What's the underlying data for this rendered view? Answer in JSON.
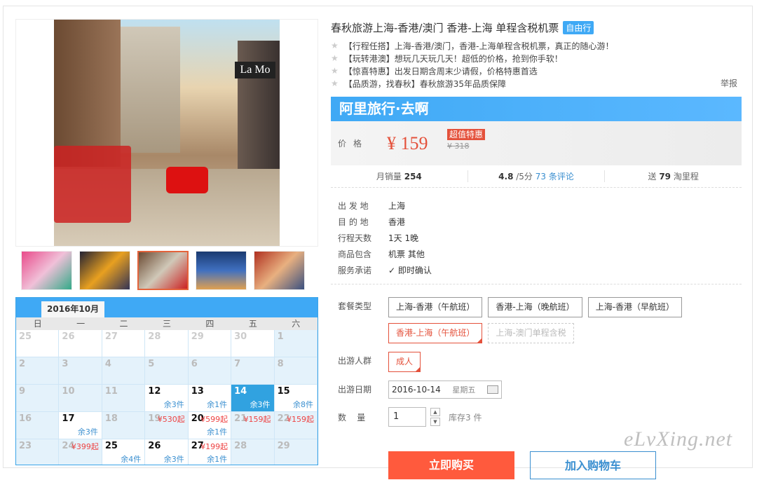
{
  "product": {
    "title": "春秋旅游上海-香港/澳门 香港-上海 单程含税机票",
    "tag": "自由行",
    "report": "举报",
    "features": [
      "【行程任搭】上海-香港/澳门，香港-上海单程含税机票，真正的随心游！",
      "【玩转港澳】想玩几天玩几天！超低的价格，抢到你手软！",
      "【惊喜特惠】出发日期含周末少请假，价格特惠首选",
      "【品质游，找春秋】春秋旅游35年品质保障"
    ]
  },
  "photo": {
    "sign": "La Mo"
  },
  "banner": "阿里旅行·去啊",
  "price": {
    "label": "价格",
    "value": "¥ 159",
    "badge": "超值特惠",
    "original": "¥ 318"
  },
  "stats": {
    "sales_label": "月销量",
    "sales": "254",
    "rating": "4.8",
    "rating_suffix": "/5分",
    "reviews": "73 条评论",
    "points_prefix": "送",
    "points": "79",
    "points_suffix": "淘里程"
  },
  "info": [
    {
      "k": "出 发 地",
      "v": "上海"
    },
    {
      "k": "目 的 地",
      "v": "香港"
    },
    {
      "k": "行程天数",
      "v": "1天 1晚"
    },
    {
      "k": "商品包含",
      "v": "机票  其他"
    },
    {
      "k": "服务承诺",
      "v": "即时确认"
    }
  ],
  "options": {
    "package_label": "套餐类型",
    "packages": [
      {
        "label": "上海-香港（午航班）",
        "state": "normal"
      },
      {
        "label": "香港-上海（晚航班）",
        "state": "normal"
      },
      {
        "label": "上海-香港（早航班）",
        "state": "normal"
      },
      {
        "label": "香港-上海（午航班）",
        "state": "selected"
      },
      {
        "label": "上海-澳门单程含税",
        "state": "disabled"
      }
    ],
    "people_label": "出游人群",
    "people": "成人",
    "date_label": "出游日期",
    "date": "2016-10-14",
    "date_weekday": "星期五",
    "qty_label": "数    量",
    "qty": "1",
    "stock": "库存3 件"
  },
  "buttons": {
    "buy": "立即购买",
    "cart": "加入购物车"
  },
  "calendar": {
    "month": "2016年10月",
    "weekdays": [
      "日",
      "一",
      "二",
      "三",
      "四",
      "五",
      "六"
    ],
    "cells": [
      {
        "d": "25",
        "t": "out"
      },
      {
        "d": "26",
        "t": "out"
      },
      {
        "d": "27",
        "t": "out"
      },
      {
        "d": "28",
        "t": "out"
      },
      {
        "d": "29",
        "t": "out"
      },
      {
        "d": "30",
        "t": "out"
      },
      {
        "d": "1",
        "t": "na"
      },
      {
        "d": "2",
        "t": "na"
      },
      {
        "d": "3",
        "t": "na"
      },
      {
        "d": "4",
        "t": "na"
      },
      {
        "d": "5",
        "t": "na"
      },
      {
        "d": "6",
        "t": "na"
      },
      {
        "d": "7",
        "t": "na"
      },
      {
        "d": "8",
        "t": "na"
      },
      {
        "d": "9",
        "t": "na"
      },
      {
        "d": "10",
        "t": "na"
      },
      {
        "d": "11",
        "t": "na"
      },
      {
        "d": "12",
        "t": "avail",
        "rem": "余3件"
      },
      {
        "d": "13",
        "t": "avail",
        "rem": "余1件"
      },
      {
        "d": "14",
        "t": "today",
        "rem": "余3件"
      },
      {
        "d": "15",
        "t": "avail",
        "rem": "余8件"
      },
      {
        "d": "16",
        "t": "na"
      },
      {
        "d": "17",
        "t": "avail",
        "rem": "余3件"
      },
      {
        "d": "18",
        "t": "na"
      },
      {
        "d": "19",
        "t": "na",
        "pr": "¥530起"
      },
      {
        "d": "20",
        "t": "avail",
        "pr": "¥599起",
        "rem": "余1件"
      },
      {
        "d": "21",
        "t": "na",
        "pr": "¥159起"
      },
      {
        "d": "22",
        "t": "na",
        "pr": "¥159起"
      },
      {
        "d": "23",
        "t": "na"
      },
      {
        "d": "24",
        "t": "na",
        "pr": "¥399起"
      },
      {
        "d": "25",
        "t": "avail",
        "rem": "余4件"
      },
      {
        "d": "26",
        "t": "avail",
        "rem": "余3件"
      },
      {
        "d": "27",
        "t": "avail",
        "pr": "¥199起",
        "rem": "余1件"
      },
      {
        "d": "28",
        "t": "na"
      },
      {
        "d": "29",
        "t": "na"
      }
    ]
  },
  "watermark": "eLvXing.net"
}
